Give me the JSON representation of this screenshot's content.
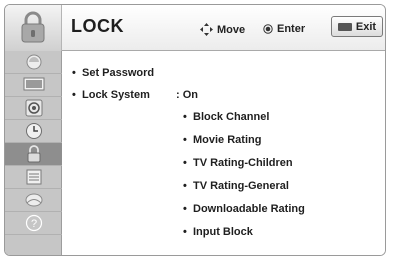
{
  "header": {
    "title": "LOCK",
    "move_label": "Move",
    "enter_label": "Enter",
    "exit_label": "Exit"
  },
  "sidebar": {
    "items": [
      {
        "icon": "picture-icon"
      },
      {
        "icon": "screen-icon"
      },
      {
        "icon": "audio-icon"
      },
      {
        "icon": "time-icon"
      },
      {
        "icon": "lock-icon",
        "active": true
      },
      {
        "icon": "option-icon"
      },
      {
        "icon": "network-icon"
      },
      {
        "icon": "help-icon"
      }
    ]
  },
  "menu": {
    "items": [
      {
        "label": "Set Password"
      },
      {
        "label": "Lock System"
      }
    ],
    "lock_system_value": ": On",
    "sub_items": [
      {
        "label": "Block Channel"
      },
      {
        "label": "Movie Rating"
      },
      {
        "label": "TV Rating-Children"
      },
      {
        "label": "TV Rating-General"
      },
      {
        "label": "Downloadable Rating"
      },
      {
        "label": "Input Block"
      }
    ]
  },
  "colors": {
    "header_bg": "#ececec",
    "sidebar_bg": "#c6c6c6",
    "sidebar_active": "#8e8e8e",
    "text": "#1f1f1f"
  }
}
